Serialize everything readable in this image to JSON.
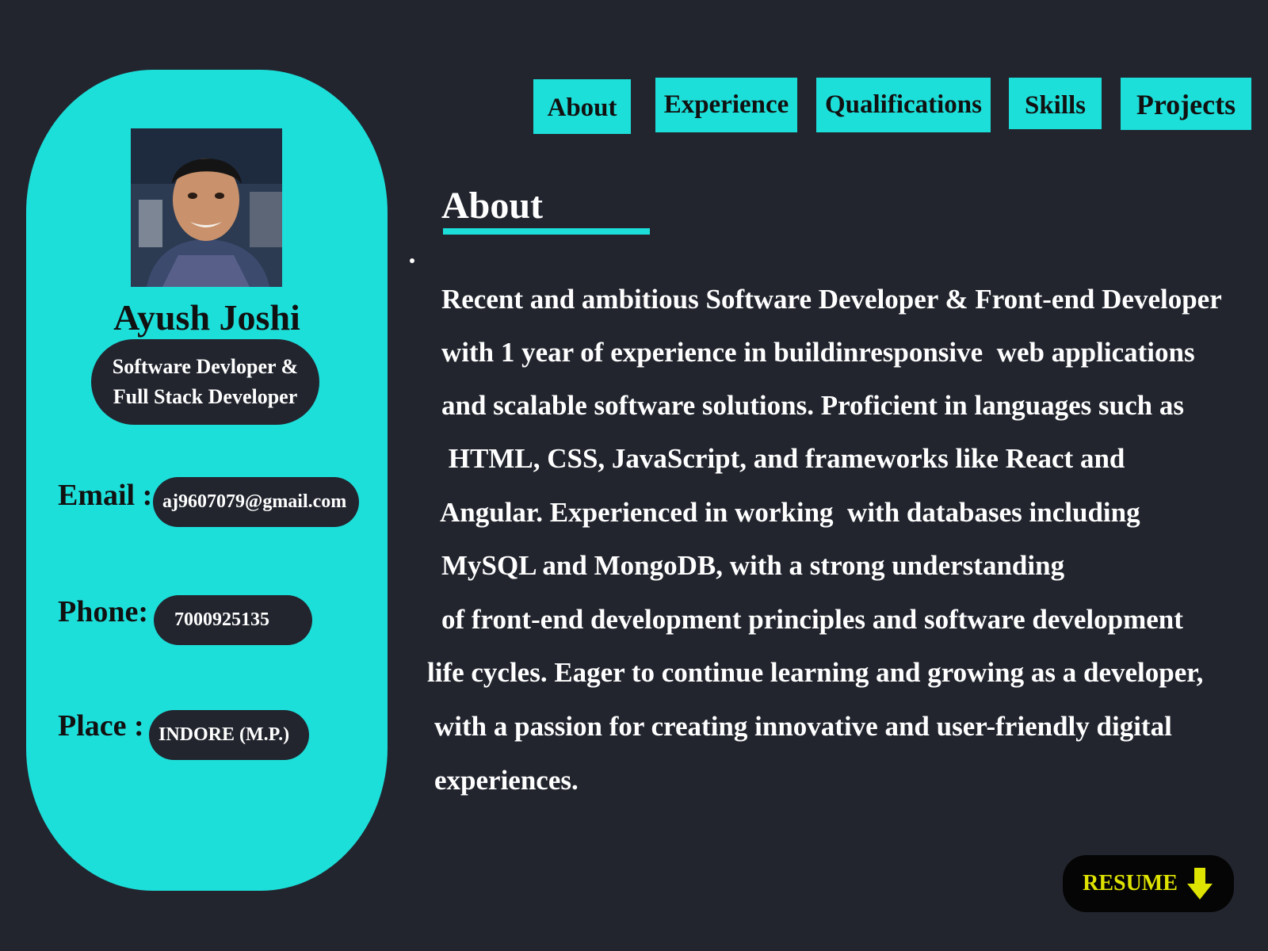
{
  "nav": {
    "items": [
      {
        "label": "About"
      },
      {
        "label": "Experience"
      },
      {
        "label": "Qualifications"
      },
      {
        "label": "Skills"
      },
      {
        "label": "Projects"
      }
    ]
  },
  "profile": {
    "name": "Ayush Joshi",
    "role": "Software Devloper &\n Full Stack Developer",
    "email_label": "Email :",
    "email": "aj9607079@gmail.com",
    "phone_label": "Phone:",
    "phone": "7000925135",
    "place_label": "Place :",
    "place": "INDORE (M.P.)"
  },
  "about": {
    "heading": "About",
    "lines": [
      "Recent and ambitious Software Developer & Front-end Developer",
      "with 1 year of experience in buildinresponsive  web applications",
      "and scalable software solutions. Proficient in languages such as",
      " HTML, CSS, JavaScript, and frameworks like React and",
      "Angular. Experienced in working  with databases including",
      "MySQL and MongoDB, with a strong understanding",
      "of front-end development principles and software development",
      "life cycles. Eager to continue learning and growing as a developer,",
      "with a passion for creating innovative and user-friendly digital",
      "experiences."
    ]
  },
  "resume": {
    "label": "RESUME",
    "icon": "arrow-down-icon"
  },
  "colors": {
    "background": "#22252e",
    "accent": "#1ddfda",
    "resume_text": "#dfe300"
  }
}
